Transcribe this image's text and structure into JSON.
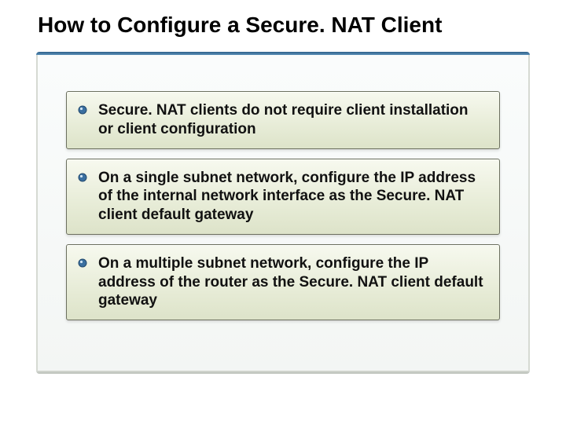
{
  "title": "How to Configure a Secure. NAT Client",
  "panel": {
    "items": [
      {
        "text": "Secure. NAT clients do not require client installation or client configuration"
      },
      {
        "text": "On a single subnet network, configure the IP address of the internal network interface as the Secure. NAT client default gateway"
      },
      {
        "text": "On a multiple subnet network, configure the IP address of the router as the Secure. NAT client default gateway"
      }
    ]
  },
  "colors": {
    "bullet_fill": "#3a6fa0",
    "bullet_stroke": "#234a6e"
  }
}
